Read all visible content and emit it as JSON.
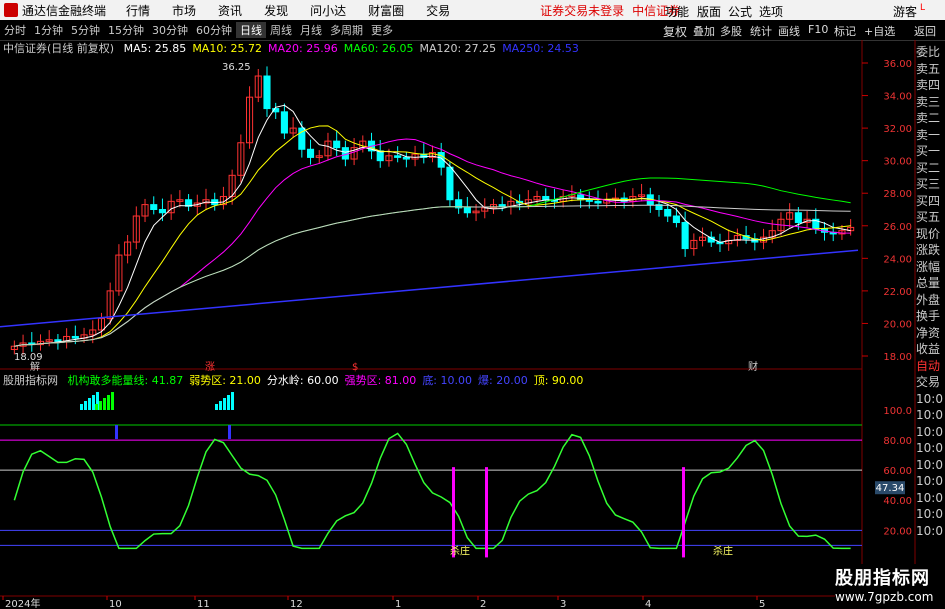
{
  "menubar": {
    "app": "通达信金融终端",
    "items": [
      "行情",
      "市场",
      "资讯",
      "发现",
      "问小达",
      "财富圈",
      "交易"
    ],
    "warn1": "证券交易未登录",
    "warn2": "中信证券",
    "right": [
      "功能",
      "版面",
      "公式",
      "选项",
      "游客"
    ]
  },
  "toolbar": {
    "periods": [
      "分时",
      "1分钟",
      "5分钟",
      "15分钟",
      "30分钟",
      "60分钟",
      "日线",
      "周线",
      "月线",
      "多周期",
      "更多"
    ],
    "active": "日线",
    "right": [
      "复权",
      "叠加",
      "多股",
      "统计",
      "画线",
      "F10",
      "标记",
      "+自选",
      "返回"
    ],
    "corner": "L"
  },
  "info": {
    "stock": "中信证券(日线 前复权)",
    "ma": [
      {
        "label": "MA5: 25.85",
        "color": "#ffffff"
      },
      {
        "label": "MA10: 25.72",
        "color": "#ffff00"
      },
      {
        "label": "MA20: 25.96",
        "color": "#ff00ff"
      },
      {
        "label": "MA60: 26.05",
        "color": "#00ff00"
      },
      {
        "label": "MA120: 27.25",
        "color": "#cccccc"
      },
      {
        "label": "MA250: 24.53",
        "color": "#3333ff"
      }
    ]
  },
  "price_axis": [
    "36.00",
    "34.00",
    "32.00",
    "30.00",
    "28.00",
    "26.00",
    "24.00",
    "22.00",
    "20.00",
    "18.00"
  ],
  "price_annot": {
    "high": "36.25",
    "low": "18.09"
  },
  "event_marks": [
    "解",
    "涨",
    "$",
    "财"
  ],
  "indicator": {
    "name": "股朋指标网",
    "items": [
      {
        "label": "机构敢多能量线: 41.87",
        "color": "#00ff00"
      },
      {
        "label": "弱势区: 21.00",
        "color": "#ffff00"
      },
      {
        "label": "分水岭: 60.00",
        "color": "#ffffff"
      },
      {
        "label": "强势区: 81.00",
        "color": "#ff00ff"
      },
      {
        "label": "底: 10.00",
        "color": "#4444ff"
      },
      {
        "label": "爆: 20.00",
        "color": "#4444ff"
      },
      {
        "label": "顶: 90.00",
        "color": "#ffff00"
      }
    ],
    "axis": [
      "100.0",
      "80.00",
      "60.00",
      "40.00",
      "20.00"
    ],
    "current": "47.34",
    "kill_label": "杀庄"
  },
  "time_axis": [
    "2024年",
    "10",
    "11",
    "12",
    "1",
    "2",
    "3",
    "4",
    "5"
  ],
  "right_panel": [
    "委比",
    "卖五",
    "卖四",
    "卖三",
    "卖二",
    "卖一",
    "买一",
    "买二",
    "买三",
    "买四",
    "买五",
    "现价",
    "涨跌",
    "涨幅",
    "总量",
    "外盘",
    "换手",
    "净资",
    "收益"
  ],
  "right_panel2": [
    "自动",
    "交易",
    "10:0",
    "10:0",
    "10:0",
    "10:0",
    "10:0",
    "10:0",
    "10:0",
    "10:0",
    "10:0"
  ],
  "watermark": {
    "line1": "股朋指标网",
    "line2": "www.7gpzb.com"
  },
  "colors": {
    "up": "#ff3232",
    "down": "#00ffff",
    "bg": "#000000"
  },
  "chart_data": {
    "type": "candlestick",
    "title": "中信证券(日线 前复权)",
    "ylim": [
      17.5,
      36.8
    ],
    "closes": [
      18.6,
      18.8,
      18.7,
      18.9,
      19.0,
      18.9,
      19.2,
      19.1,
      19.3,
      19.6,
      20.3,
      22.0,
      24.2,
      25.0,
      26.6,
      27.3,
      27.0,
      26.8,
      27.5,
      27.6,
      27.2,
      27.4,
      27.6,
      27.3,
      27.8,
      29.1,
      31.1,
      33.9,
      35.2,
      33.2,
      33.0,
      31.7,
      32.0,
      30.7,
      30.2,
      30.3,
      31.2,
      30.8,
      30.1,
      30.8,
      31.2,
      30.6,
      30.0,
      30.3,
      30.2,
      30.1,
      30.4,
      30.2,
      30.5,
      29.6,
      27.6,
      27.1,
      26.8,
      26.9,
      27.1,
      27.3,
      27.2,
      27.5,
      27.4,
      27.6,
      27.8,
      27.6,
      27.5,
      27.8,
      27.9,
      27.6,
      27.5,
      27.4,
      27.6,
      27.7,
      27.5,
      27.8,
      27.9,
      27.3,
      27.0,
      26.6,
      26.2,
      24.6,
      25.1,
      25.3,
      25.0,
      24.9,
      25.1,
      25.4,
      25.2,
      25.0,
      25.3,
      25.7,
      26.4,
      26.8,
      26.2,
      26.4,
      25.8,
      25.6,
      25.5,
      25.7,
      25.9
    ]
  }
}
